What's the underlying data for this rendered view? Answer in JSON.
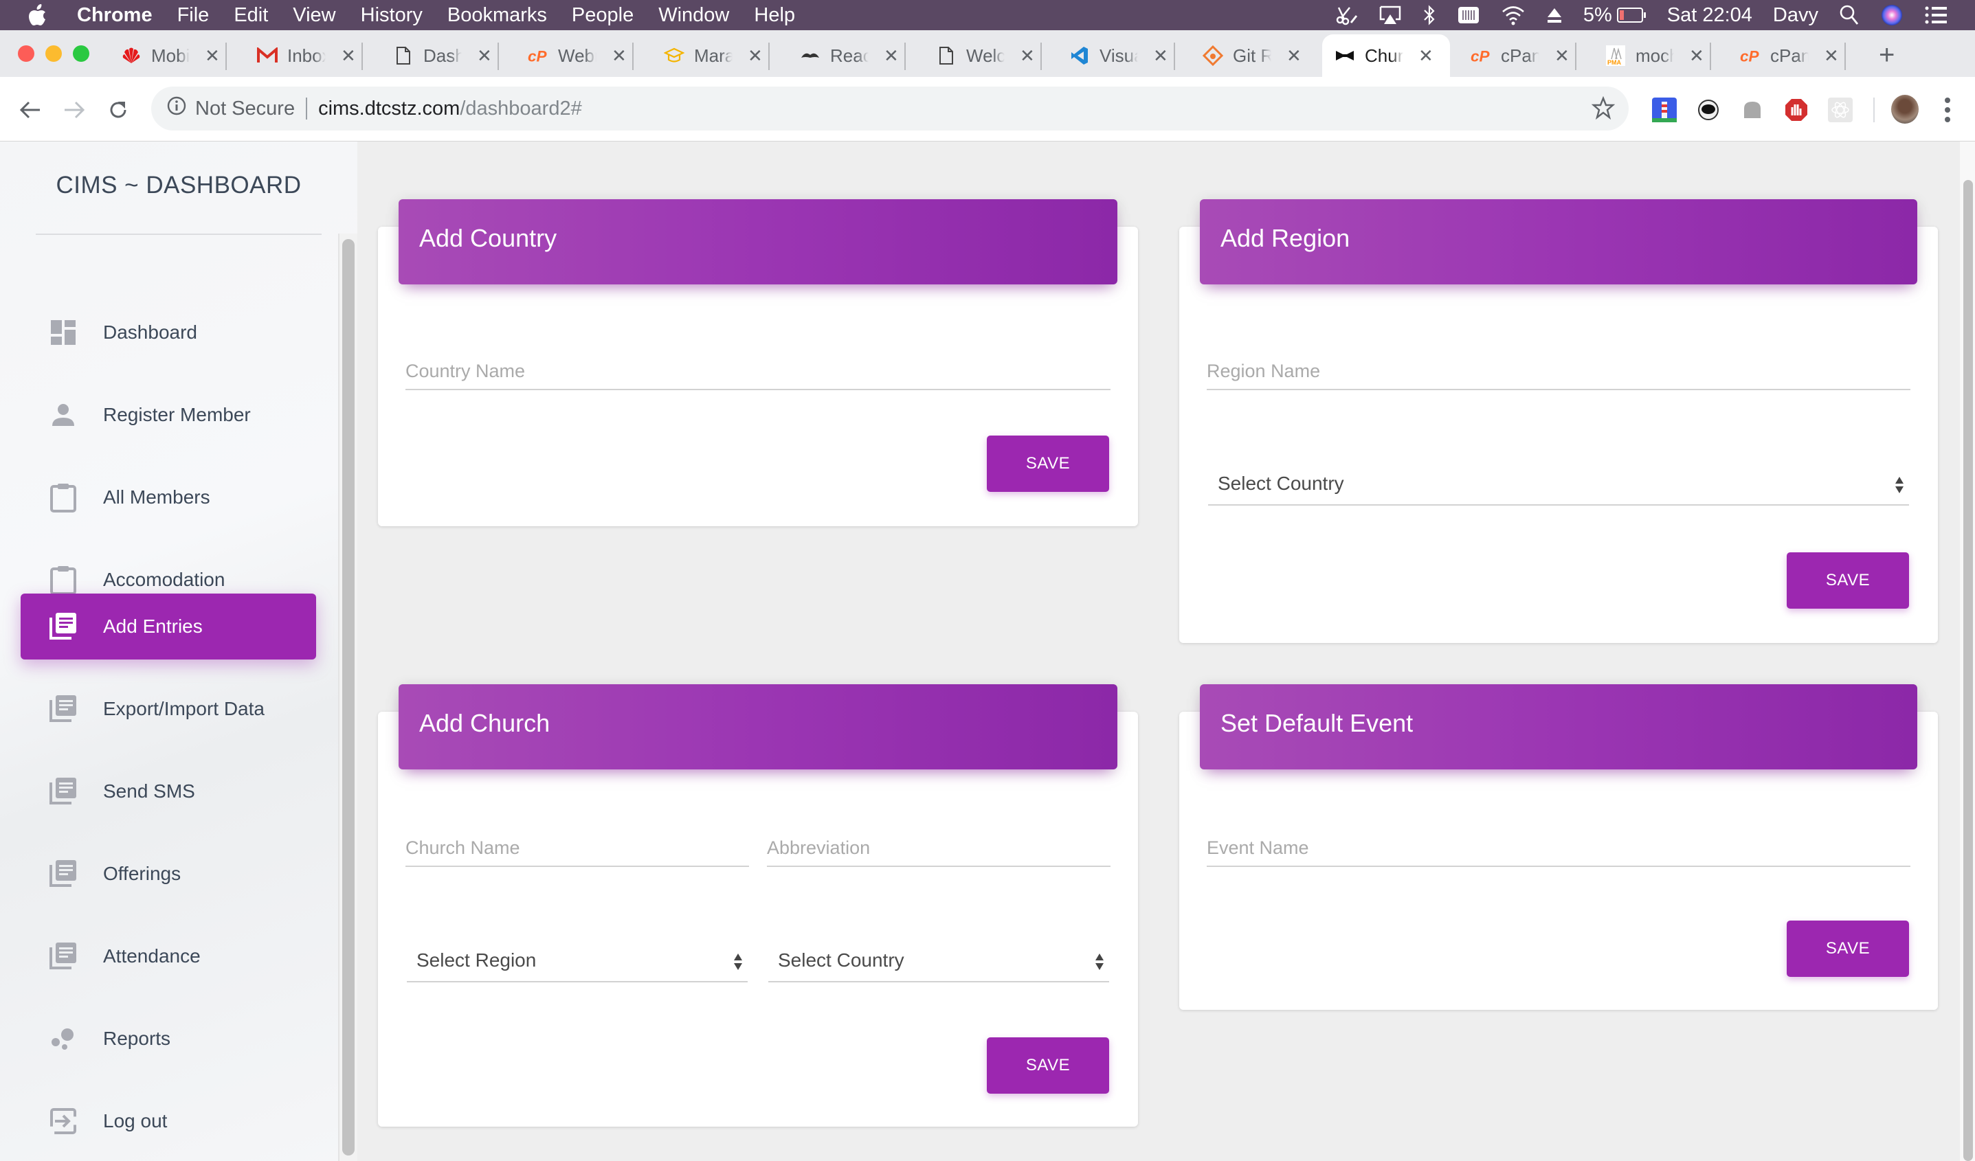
{
  "menubar": {
    "app": "Chrome",
    "items": [
      "File",
      "Edit",
      "View",
      "History",
      "Bookmarks",
      "People",
      "Window",
      "Help"
    ],
    "status": {
      "battery_percent": "5%",
      "clock": "Sat 22:04",
      "user": "Davy"
    },
    "status_icons": [
      "scissors-pen-icon",
      "airplay-icon",
      "bluetooth-icon",
      "keyboard-icon",
      "wifi-icon",
      "eject-icon",
      "battery-icon",
      "spotlight-search-icon",
      "siri-icon",
      "notification-center-icon"
    ]
  },
  "browser": {
    "tabs": [
      {
        "label": "Mobile",
        "icon": "huawei-icon",
        "active": false
      },
      {
        "label": "Inbox",
        "icon": "gmail-icon",
        "active": false
      },
      {
        "label": "Dashb",
        "icon": "document-icon",
        "active": false
      },
      {
        "label": "Webm",
        "icon": "cpanel-icon",
        "active": false
      },
      {
        "label": "Maran",
        "icon": "graduation-cap-icon",
        "active": false
      },
      {
        "label": "React",
        "icon": "mustache-icon",
        "active": false
      },
      {
        "label": "Welco",
        "icon": "document-icon",
        "active": false
      },
      {
        "label": "Visual",
        "icon": "vscode-icon",
        "active": false
      },
      {
        "label": "Git Re",
        "icon": "git-icon",
        "active": false
      },
      {
        "label": "Churc",
        "icon": "bowtie-icon",
        "active": true
      },
      {
        "label": "cPane",
        "icon": "cpanel-icon",
        "active": false
      },
      {
        "label": "mocha",
        "icon": "phpmyadmin-icon",
        "active": false
      },
      {
        "label": "cPane",
        "icon": "cpanel-icon",
        "active": false
      }
    ],
    "tab_close_glyph": "✕",
    "new_tab_glyph": "+",
    "security_label": "Not Secure",
    "url_host": "cims.dtcstz.com",
    "url_path": "/dashboard2#",
    "extensions": [
      "lighthouse-icon",
      "astronaut-icon",
      "ghost-icon",
      "adblock-icon",
      "react-devtools-icon"
    ]
  },
  "sidebar": {
    "brand": "CIMS ~ DASHBOARD",
    "items": [
      {
        "label": "Dashboard",
        "icon": "dashboard-icon",
        "active": false
      },
      {
        "label": "Register Member",
        "icon": "person-icon",
        "active": false
      },
      {
        "label": "All Members",
        "icon": "clipboard-icon",
        "active": false
      },
      {
        "label": "Accomodation",
        "icon": "clipboard-icon",
        "active": false
      },
      {
        "label": "Add Entries",
        "icon": "library-books-icon",
        "active": true
      },
      {
        "label": "Export/Import Data",
        "icon": "library-books-icon",
        "active": false
      },
      {
        "label": "Send SMS",
        "icon": "library-books-icon",
        "active": false
      },
      {
        "label": "Offerings",
        "icon": "library-books-icon",
        "active": false
      },
      {
        "label": "Attendance",
        "icon": "library-books-icon",
        "active": false
      },
      {
        "label": "Reports",
        "icon": "bubble-chart-icon",
        "active": false
      },
      {
        "label": "Log out",
        "icon": "logout-icon",
        "active": false
      }
    ]
  },
  "cards": {
    "country": {
      "title": "Add Country",
      "name_placeholder": "Country Name",
      "save_label": "SAVE"
    },
    "region": {
      "title": "Add Region",
      "name_placeholder": "Region Name",
      "country_select": "Select Country",
      "save_label": "SAVE"
    },
    "church": {
      "title": "Add Church",
      "name_placeholder": "Church Name",
      "abbr_placeholder": "Abbreviation",
      "region_select": "Select Region",
      "country_select": "Select Country",
      "save_label": "SAVE"
    },
    "event": {
      "title": "Set Default Event",
      "name_placeholder": "Event Name",
      "save_label": "SAVE"
    }
  },
  "colors": {
    "accent": "#9c27b0",
    "menubar": "#5a4863",
    "sidebar_text": "#3c4858"
  }
}
